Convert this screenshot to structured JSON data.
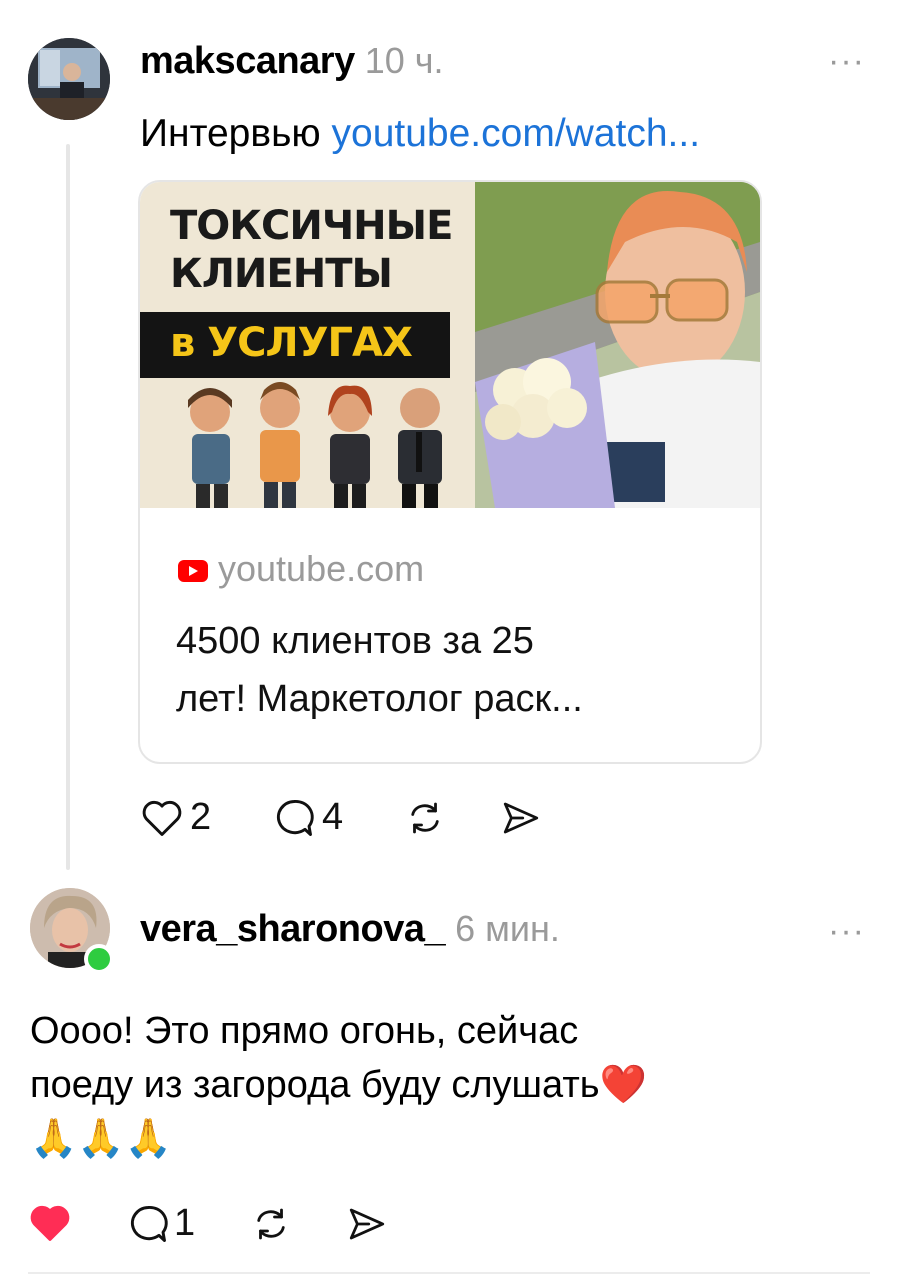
{
  "post": {
    "username": "makscanary",
    "time": "10 ч.",
    "more_label": "···",
    "text": "Интервью",
    "link_text": "youtube.com/watch...",
    "card": {
      "thumbnail_headline_line1": "ТОКСИЧНЫЕ",
      "thumbnail_headline_line2": "КЛИЕНТЫ",
      "thumbnail_headline_line3": "в УСЛУГАХ",
      "domain": "youtube.com",
      "title_line1": "4500 клиентов за 25",
      "title_line2": "лет! Маркетолог раск..."
    },
    "likes": "2",
    "comments": "4"
  },
  "reply": {
    "username": "vera_sharonova_",
    "time": "6 мин.",
    "more_label": "···",
    "text_line1": "Оооо! Это прямо огонь, сейчас",
    "text_line2": "поеду из загорода буду слушать❤️",
    "text_line3": "🙏🙏🙏",
    "comments": "1",
    "liked": true
  },
  "colors": {
    "link": "#1c73d8",
    "muted": "#9a9a9a",
    "like_active": "#ff2d55",
    "online": "#2ecc40"
  },
  "icons": [
    "heart-icon",
    "comment-icon",
    "repost-icon",
    "share-icon",
    "more-icon",
    "youtube-icon"
  ]
}
